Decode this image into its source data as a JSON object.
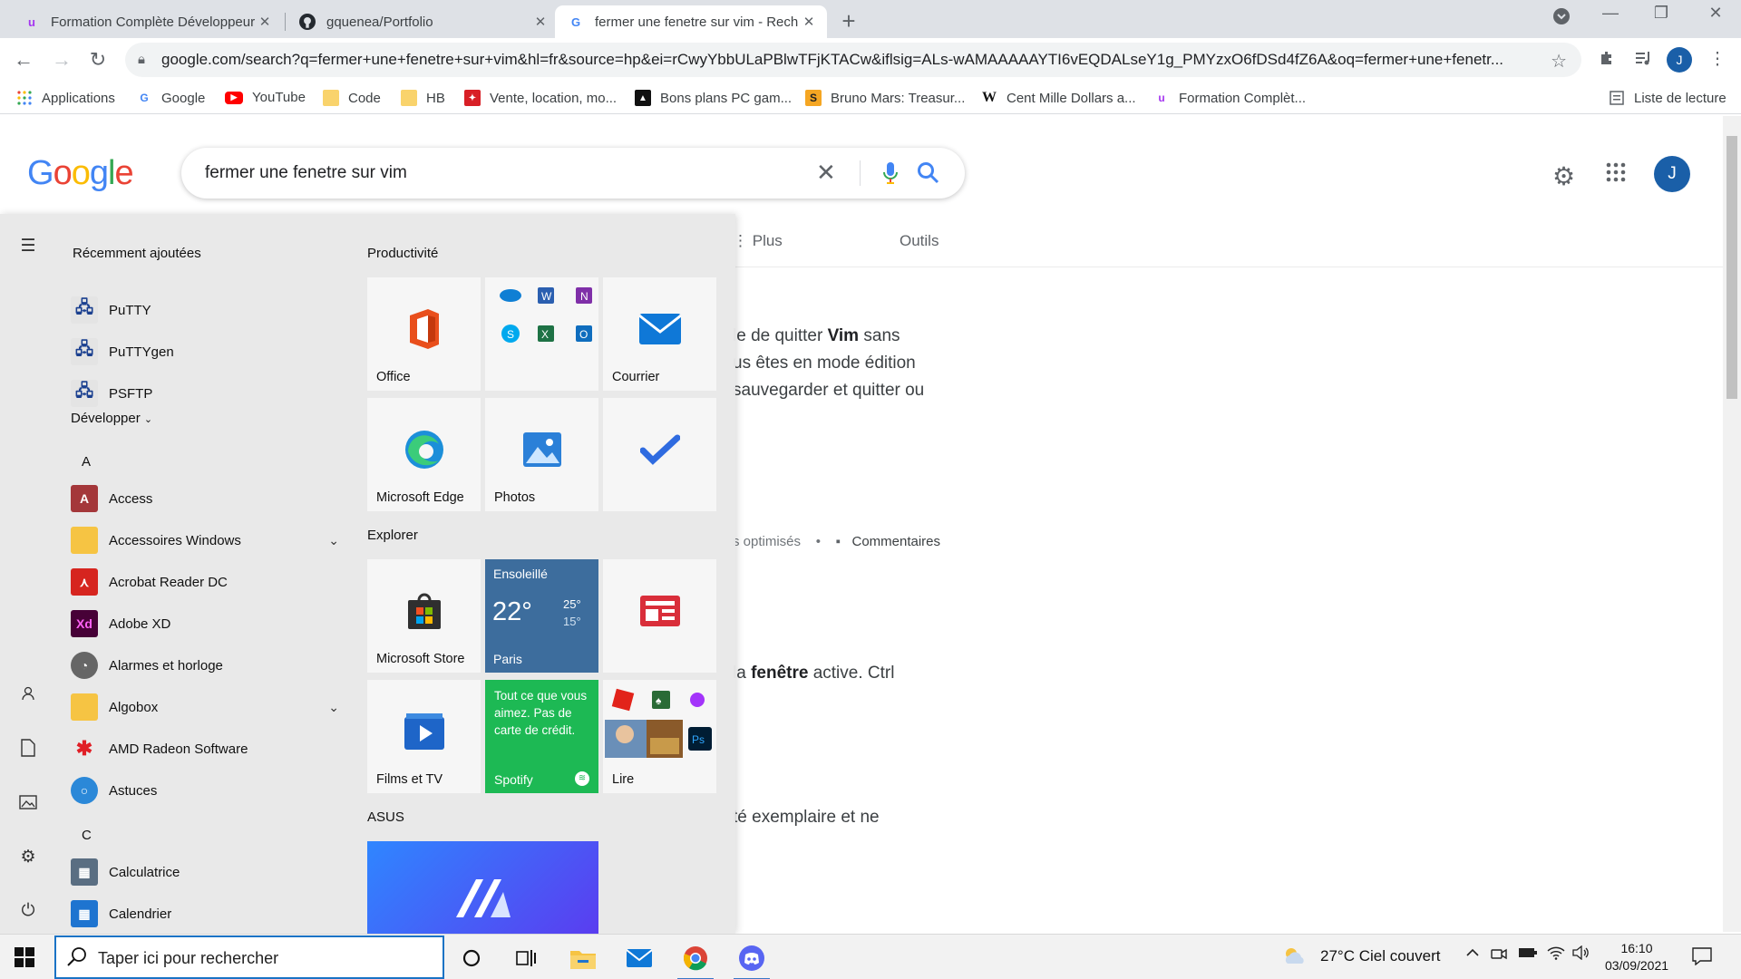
{
  "browser": {
    "tabs": [
      {
        "title": "Formation Complète Développeur",
        "favicon": "u"
      },
      {
        "title": "gquenea/Portfolio",
        "favicon": "github"
      },
      {
        "title": "fermer une fenetre sur vim - Rech",
        "favicon": "G"
      }
    ],
    "url": "google.com/search?q=fermer+une+fenetre+sur+vim&hl=fr&source=hp&ei=rCwyYbbULaPBlwTFjKTACw&iflsig=ALs-wAMAAAAAYTI6vEQDALseY1g_PMYzxO6fDSd4fZ6A&oq=fermer+une+fenetr...",
    "avatar": "J",
    "bookmarks": [
      "Applications",
      "Google",
      "YouTube",
      "Code",
      "HB",
      "Vente, location, mo...",
      "Bons plans PC gam...",
      "Bruno Mars: Treasur...",
      "Cent Mille Dollars a...",
      "Formation Complèt..."
    ],
    "reading_list": "Liste de lecture"
  },
  "google": {
    "query": "fermer une fenetre sur vim",
    "avatar": "J",
    "tabs": [
      "Plus",
      "Outils"
    ],
    "snippet1": [
      "le de quitter ",
      "Vim",
      " sans",
      "us êtes en mode édition",
      "sauvegarder et quitter ou"
    ],
    "meta": [
      "s optimisés",
      "•",
      "Commentaires"
    ],
    "snippet2": [
      "la ",
      "fenêtre",
      " active. Ctrl"
    ],
    "snippet3": "té exemplaire et ne"
  },
  "startmenu": {
    "recent_header": "Récemment ajoutées",
    "recent": [
      "PuTTY",
      "PuTTYgen",
      "PSFTP"
    ],
    "expand": "Développer",
    "letters": [
      "A",
      "C"
    ],
    "apps": [
      "Access",
      "Accessoires Windows",
      "Acrobat Reader DC",
      "Adobe XD",
      "Alarmes et horloge",
      "Algobox",
      "AMD Radeon Software",
      "Astuces",
      "Calculatrice",
      "Calendrier"
    ],
    "groups": [
      "Productivité",
      "Explorer",
      "ASUS"
    ],
    "tiles": {
      "office": "Office",
      "courrier": "Courrier",
      "edge": "Microsoft Edge",
      "photos": "Photos",
      "store": "Microsoft Store",
      "films": "Films et TV",
      "lire": "Lire",
      "weather_cond": "Ensoleillé",
      "weather_temp": "22°",
      "weather_hi": "25°",
      "weather_lo": "15°",
      "weather_city": "Paris",
      "spotify_text": "Tout ce que vous aimez. Pas de carte de crédit.",
      "spotify": "Spotify"
    }
  },
  "taskbar": {
    "search_placeholder": "Taper ici pour rechercher",
    "weather": "27°C  Ciel couvert",
    "time": "16:10",
    "date": "03/09/2021"
  }
}
